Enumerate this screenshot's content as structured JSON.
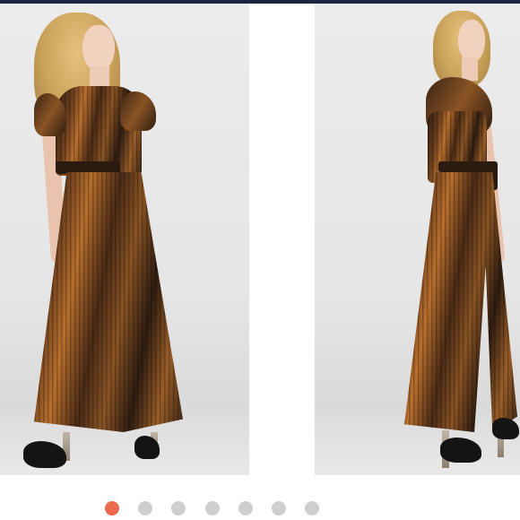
{
  "carousel": {
    "slides": [
      {
        "name": "model-front-view"
      },
      {
        "name": "model-side-view"
      }
    ],
    "pager": {
      "total": 7,
      "active_index": 0,
      "active_color": "#ec6a4c",
      "inactive_color": "#cfcfcf"
    }
  },
  "colors": {
    "top_bar": "#1b2540",
    "background": "#ffffff",
    "photo_backdrop": "#e6e6e6"
  }
}
